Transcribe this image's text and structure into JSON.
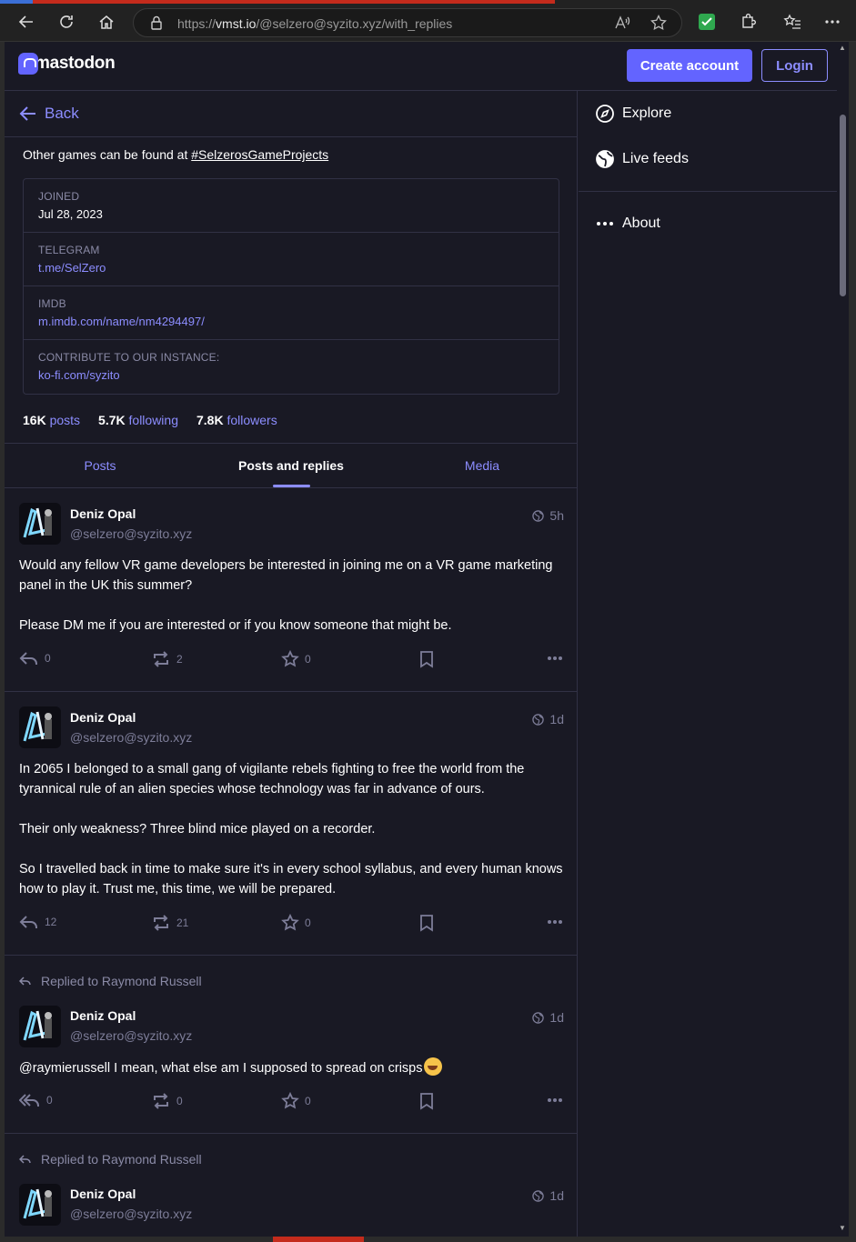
{
  "browser": {
    "url_prefix": "https://",
    "url_domain": "vmst.io",
    "url_path": "/@selzero@syzito.xyz/with_replies"
  },
  "header": {
    "logo_text": "mastodon",
    "create_account": "Create account",
    "login": "Login"
  },
  "back_label": "Back",
  "profile": {
    "bio_prefix": "Other games can be found at ",
    "bio_hashtag": "#SelzerosGameProjects",
    "fields": [
      {
        "label": "JOINED",
        "value": "Jul 28, 2023"
      },
      {
        "label": "TELEGRAM",
        "value": "t.me/SelZero"
      },
      {
        "label": "IMDB",
        "value": "m.imdb.com/name/nm4294497/"
      },
      {
        "label": "CONTRIBUTE TO OUR INSTANCE:",
        "value": "ko-fi.com/syzito"
      }
    ],
    "counts": {
      "posts_num": "16K",
      "posts_label": "posts",
      "following_num": "5.7K",
      "following_label": "following",
      "followers_num": "7.8K",
      "followers_label": "followers"
    }
  },
  "tabs": [
    "Posts",
    "Posts and replies",
    "Media"
  ],
  "posts": [
    {
      "name": "Deniz Opal",
      "handle": "@selzero@syzito.xyz",
      "time": "5h",
      "paragraphs": [
        "Would any fellow VR game developers be interested in joining me on a VR game marketing panel in the UK this summer?",
        "Please DM me if you are interested or if you know someone that might be."
      ],
      "replies": "0",
      "boosts": "2",
      "favs": "0"
    },
    {
      "name": "Deniz Opal",
      "handle": "@selzero@syzito.xyz",
      "time": "1d",
      "paragraphs": [
        "In 2065 I belonged to a small gang of vigilante rebels fighting to free the world from the tyrannical rule of an alien species whose technology was far in advance of ours.",
        "Their only weakness? Three blind mice played on a recorder.",
        "So I travelled back in time to make sure it's in every school syllabus, and every human knows how to play it. Trust me, this time, we will be prepared."
      ],
      "replies": "12",
      "boosts": "21",
      "favs": "0"
    },
    {
      "replied_to": "Replied to Raymond Russell",
      "name": "Deniz Opal",
      "handle": "@selzero@syzito.xyz",
      "time": "1d",
      "text": "@raymierussell I mean, what else am I supposed to spread on crisps",
      "replies": "0",
      "boosts": "0",
      "favs": "0"
    },
    {
      "replied_to": "Replied to Raymond Russell",
      "name": "Deniz Opal",
      "handle": "@selzero@syzito.xyz",
      "time": "1d"
    }
  ],
  "sidebar": {
    "explore": "Explore",
    "live_feeds": "Live feeds",
    "about": "About"
  },
  "colors": {
    "accent": "#6364ff",
    "link": "#8c8dff",
    "background": "#191924",
    "border": "#313145"
  }
}
